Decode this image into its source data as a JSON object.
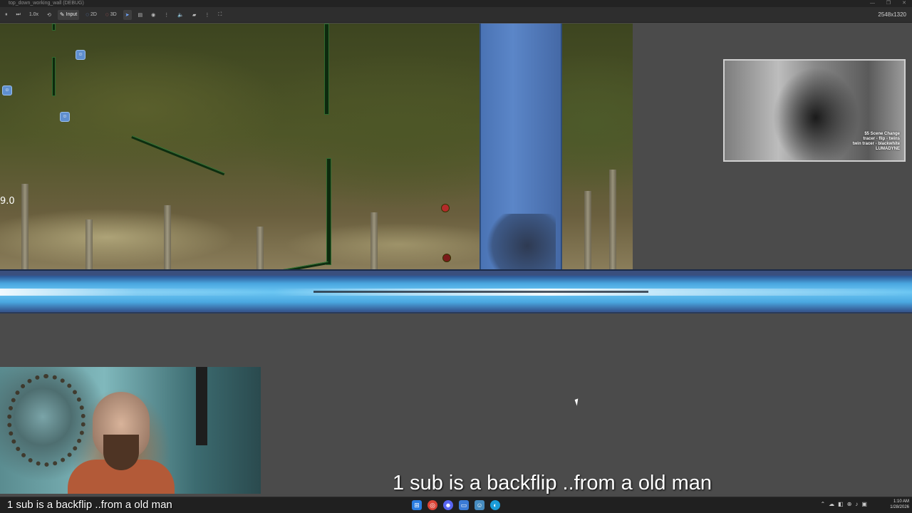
{
  "window": {
    "title": "top_down_working_wall (DEBUG)",
    "controls": [
      "—",
      "❐",
      "✕"
    ]
  },
  "toolbar": {
    "zoom": "1.0x",
    "input_label": "Input",
    "mode_2d": "2D",
    "mode_3d": "3D",
    "resolution": "2548x1320"
  },
  "scene": {
    "coordinate_readout": "9.0"
  },
  "stream_overlay": {
    "text_line1": "$5 Scene Change",
    "text_line2": "tracer - flip - twins",
    "text_line3": "twin tracer - blackwhite",
    "text_line4": "LUMADYNE"
  },
  "captions": {
    "main": "1 sub is a backflip ..from a old man",
    "webcam": "1 sub is a backflip ..from a old man"
  },
  "taskbar": {
    "time": "1:10 AM",
    "date": "1/28/2026",
    "apps": [
      "windows-start",
      "chrome",
      "discord",
      "file-explorer",
      "terminal",
      "browser"
    ]
  },
  "colors": {
    "accent_blue": "#4aa7e0",
    "pillar_blue": "#5b86c8",
    "wall_green": "#0d2a0e"
  }
}
